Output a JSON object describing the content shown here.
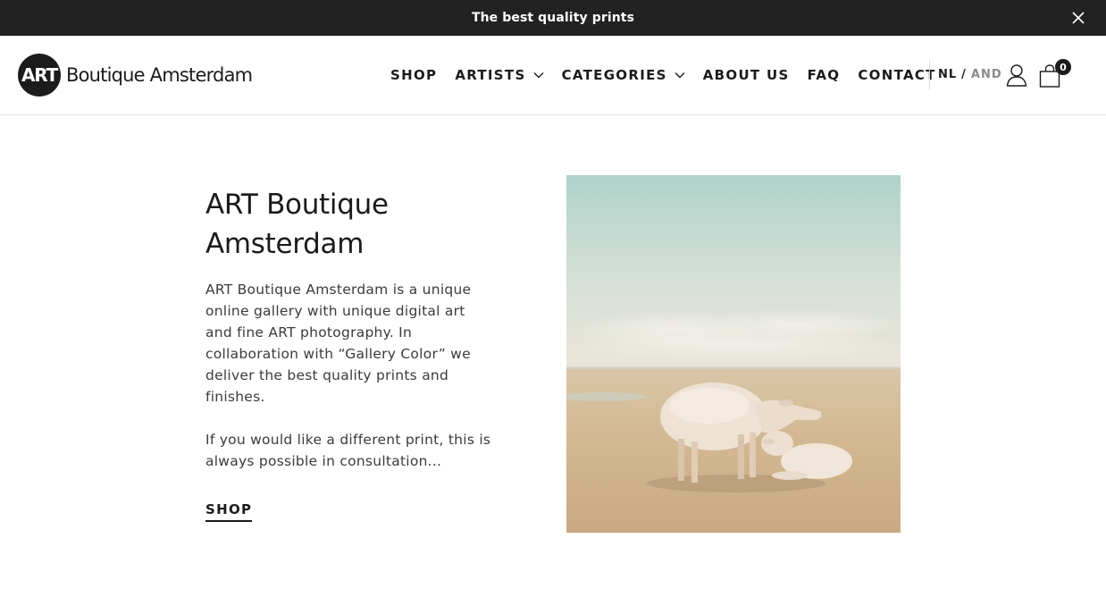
{
  "announcement": {
    "text": "The best quality prints",
    "close_icon": "close-icon"
  },
  "header": {
    "logo_mark": "ART",
    "logo_text": "Boutique Amsterdam",
    "nav": [
      {
        "label": "SHOP",
        "has_dropdown": false
      },
      {
        "label": "ARTISTS",
        "has_dropdown": true
      },
      {
        "label": "CATEGORIES",
        "has_dropdown": true
      },
      {
        "label": "ABOUT US",
        "has_dropdown": false
      },
      {
        "label": "FAQ",
        "has_dropdown": false
      },
      {
        "label": "CONTACT",
        "has_dropdown": false
      }
    ],
    "lang_nl": "NL",
    "lang_sep": "/",
    "lang_en": "AND",
    "account_icon": "user-icon",
    "cart_icon": "shopping-bag-icon",
    "cart_count": "0"
  },
  "intro": {
    "title": "ART Boutique Amsterdam",
    "paragraph1": "ART Boutique Amsterdam is a unique online gallery with unique digital art and fine ART photography. In collaboration with “Gallery Color” we deliver the best quality prints and finishes.",
    "paragraph2": "If you would like a different print, this is always possible in consultation...",
    "cta_label": "SHOP"
  },
  "colors": {
    "announcement_bg": "#222222",
    "text": "#1b1b1b",
    "muted": "#8a8a8a"
  }
}
